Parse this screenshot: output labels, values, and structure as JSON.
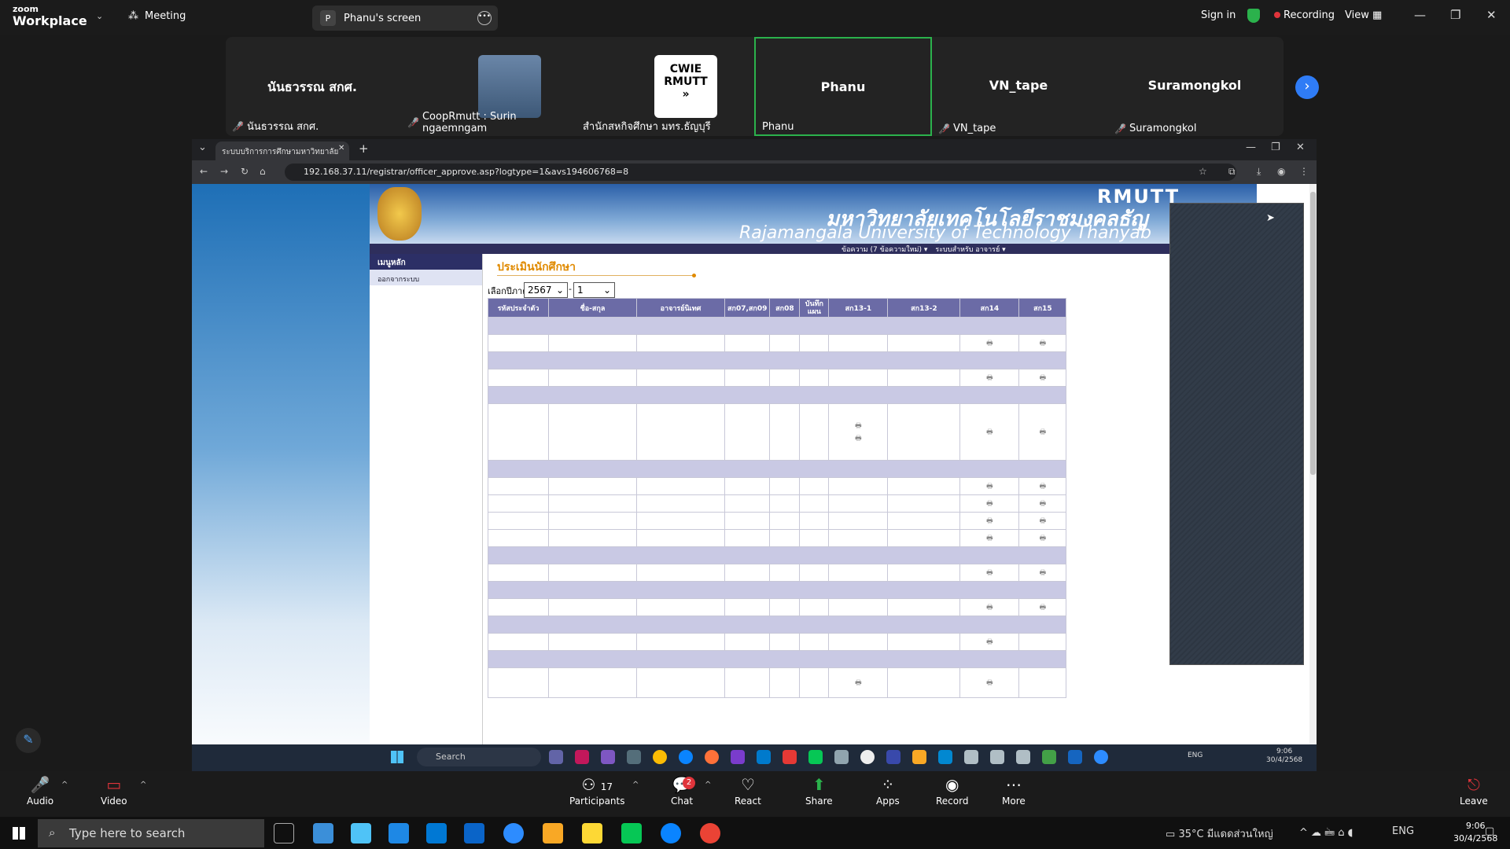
{
  "zoom": {
    "brand_top": "zoom",
    "brand_bottom": "Workplace",
    "meeting_label": "Meeting",
    "screen_pill": "Phanu's screen",
    "screen_pill_initial": "P",
    "sign_in": "Sign in",
    "recording": "Recording",
    "view": "View"
  },
  "participants": [
    {
      "big": "นันธวรรณ สกศ.",
      "name": "นันธวรรณ สกศ.",
      "muted": true
    },
    {
      "big": "",
      "name": "CoopRmutt : Surin ngaemngam",
      "muted": true
    },
    {
      "big": "",
      "name": "สำนักสหกิจศึกษา มทร.ธัญบุรี",
      "muted": false
    },
    {
      "big": "Phanu",
      "name": "Phanu",
      "muted": false
    },
    {
      "big": "VN_tape",
      "name": "VN_tape",
      "muted": true
    },
    {
      "big": "Suramongkol",
      "name": "Suramongkol",
      "muted": true
    }
  ],
  "cwie_logo": {
    "line1": "CWIE",
    "line2": "RMUTT",
    "line3": "»"
  },
  "browser": {
    "tab_title": "ระบบบริการการศึกษามหาวิทยาลัย",
    "url": "192.168.37.11/registrar/officer_approve.asp?logtype=1&avs194606768=8"
  },
  "site": {
    "banner_thai": "มหาวิทยาลัยเทคโนโลยีราชมงคลธัญ",
    "banner_en": "Rajamangala University of Technology Thanyab",
    "banner_rm": "RMUTT",
    "menu": [
      "ข้อความ (7 ข้อความใหม่) ▾",
      "ระบบสำหรับ อาจารย์ ▾"
    ],
    "side_main": "เมนูหลัก",
    "side_logout": "ออกจากระบบ"
  },
  "page": {
    "title": "ประเมินนักศึกษา",
    "term_label": "เลือกปีภาค",
    "year": "2567",
    "term": "1"
  },
  "table": {
    "headers": [
      "รหัสประจำตัว",
      "ชื่อ-สกุล",
      "อาจารย์นิเทศ",
      "สก07,สก09",
      "สก08",
      "บันทึกแผน",
      "สก13-1",
      "สก13-2",
      "สก14",
      "สก15"
    ]
  },
  "win_taskbar_inner": {
    "search": "Search",
    "lang": "ENG",
    "time": "9:06",
    "date": "30/4/2568"
  },
  "zoom_controls": {
    "audio": "Audio",
    "video": "Video",
    "participants": "Participants",
    "participants_count": "17",
    "chat": "Chat",
    "chat_badge": "2",
    "react": "React",
    "share": "Share",
    "apps": "Apps",
    "record": "Record",
    "more": "More",
    "leave": "Leave"
  },
  "win_taskbar": {
    "search": "Type here to search",
    "weather": "35°C",
    "weather_text": "มีแดดส่วนใหญ่",
    "lang": "ENG",
    "time": "9:06",
    "date": "30/4/2568"
  }
}
